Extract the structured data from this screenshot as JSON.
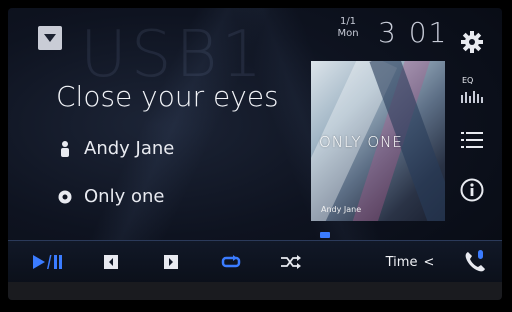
{
  "source": {
    "watermark": "USB1",
    "menu_icon": "chevron-down-icon"
  },
  "clock": {
    "date_line1": "1/1",
    "date_line2": "Mon",
    "time": "3 01"
  },
  "track": {
    "title": "Close your eyes",
    "artist": "Andy Jane",
    "album": "Only one",
    "artist_icon": "person-icon",
    "album_icon": "disc-icon"
  },
  "album_art": {
    "title": "ONLY ONE",
    "artist": "Andy Jane"
  },
  "side_buttons": {
    "settings_icon": "gear-icon",
    "eq_label": "EQ",
    "list_icon": "list-icon",
    "info_icon": "info-icon"
  },
  "controls": {
    "play_pause_icon": "play-pause-icon",
    "prev_icon": "previous-track-icon",
    "next_icon": "next-track-icon",
    "repeat_icon": "repeat-icon",
    "shuffle_icon": "shuffle-icon",
    "time_label": "Time",
    "time_arrow": "<",
    "phone_icon": "phone-icon"
  },
  "colors": {
    "accent": "#3b7cff",
    "text": "#f2f4f8",
    "background": "#0e1320"
  }
}
